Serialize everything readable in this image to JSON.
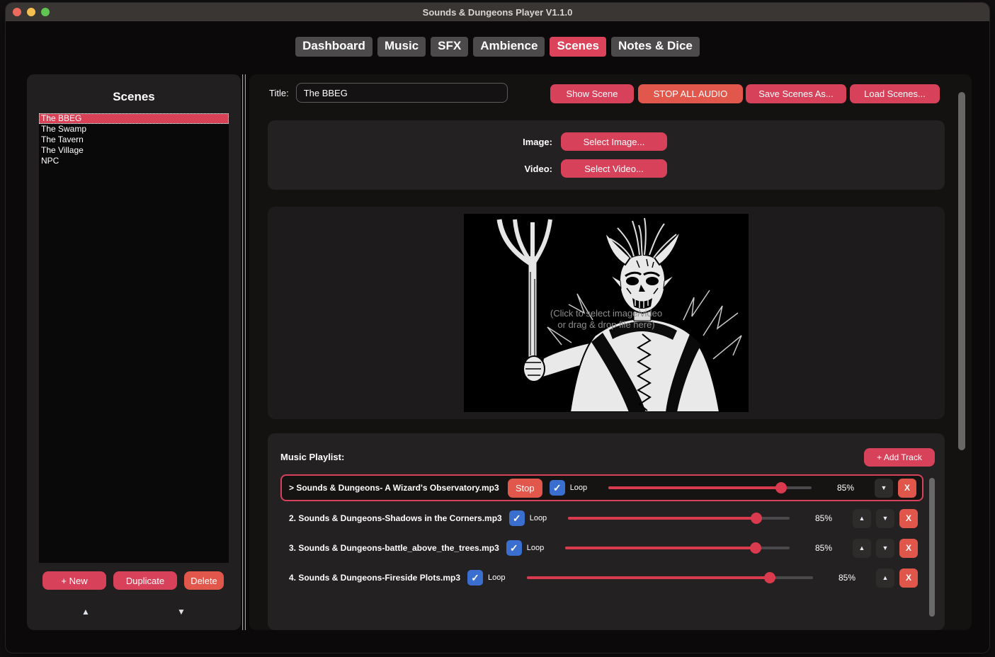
{
  "window": {
    "title": "Sounds & Dungeons Player V1.1.0"
  },
  "icons": {
    "up_arrow": "▲",
    "down_arrow": "▼",
    "checkmark": "✓"
  },
  "colors": {
    "accent_red": "#d8415a",
    "accent_orange": "#e2574b",
    "tab_active_red": "#dc4259",
    "checkbox_blue": "#3a6fd0",
    "slider_red": "#d93a4e",
    "titlebar_gray": "#3a3634"
  },
  "tabs": [
    {
      "label": "Dashboard",
      "active": false
    },
    {
      "label": "Music",
      "active": false
    },
    {
      "label": "SFX",
      "active": false
    },
    {
      "label": "Ambience",
      "active": false
    },
    {
      "label": "Scenes",
      "active": true
    },
    {
      "label": "Notes & Dice",
      "active": false
    }
  ],
  "sidebar": {
    "heading": "Scenes",
    "items": [
      {
        "label": "The BBEG",
        "selected": true
      },
      {
        "label": "The Swamp",
        "selected": false
      },
      {
        "label": "The Tavern",
        "selected": false
      },
      {
        "label": "The Village",
        "selected": false
      },
      {
        "label": "NPC",
        "selected": false
      }
    ],
    "new_label": "+ New",
    "duplicate_label": "Duplicate",
    "delete_label": "Delete"
  },
  "header": {
    "title_label": "Title:",
    "title_value": "The BBEG",
    "show_scene_label": "Show Scene",
    "stop_all_label": "STOP ALL AUDIO",
    "save_scenes_label": "Save Scenes As...",
    "load_scenes_label": "Load Scenes..."
  },
  "media": {
    "image_label": "Image:",
    "image_button": "Select Image...",
    "video_label": "Video:",
    "video_button": "Select Video...",
    "overlay_line1": "(Click to select image/video",
    "overlay_line2": "or drag & drop file here)"
  },
  "playlist": {
    "heading": "Music Playlist:",
    "add_label": "+ Add Track",
    "remove_label": "X",
    "tracks": [
      {
        "name": "> Sounds & Dungeons- A Wizard's Observatory.mp3",
        "playing": true,
        "stop_label": "Stop",
        "loop_checked": true,
        "loop_label": "Loop",
        "volume_label": "85%",
        "volume_pct": 85,
        "has_up": false,
        "has_down": true
      },
      {
        "name": "2. Sounds & Dungeons-Shadows in the Corners.mp3",
        "playing": false,
        "loop_checked": true,
        "loop_label": "Loop",
        "volume_label": "85%",
        "volume_pct": 85,
        "has_up": true,
        "has_down": true
      },
      {
        "name": "3. Sounds & Dungeons-battle_above_the_trees.mp3",
        "playing": false,
        "loop_checked": true,
        "loop_label": "Loop",
        "volume_label": "85%",
        "volume_pct": 85,
        "has_up": true,
        "has_down": true
      },
      {
        "name": "4. Sounds & Dungeons-Fireside Plots.mp3",
        "playing": false,
        "loop_checked": true,
        "loop_label": "Loop",
        "volume_label": "85%",
        "volume_pct": 85,
        "has_up": true,
        "has_down": false
      }
    ]
  }
}
